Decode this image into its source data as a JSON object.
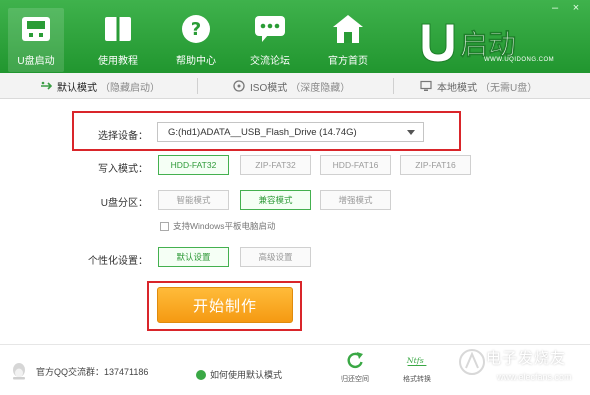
{
  "nav": {
    "items": [
      {
        "label": "U盘启动",
        "icon": "usb-drive-icon",
        "active": true
      },
      {
        "label": "使用教程",
        "icon": "book-icon",
        "active": false
      },
      {
        "label": "帮助中心",
        "icon": "question-icon",
        "active": false
      },
      {
        "label": "交流论坛",
        "icon": "chat-icon",
        "active": false
      },
      {
        "label": "官方首页",
        "icon": "home-icon",
        "active": false
      }
    ]
  },
  "brand": {
    "logo_text": "U启动",
    "logo_sub": "WWW.UQIDONG.COM"
  },
  "tabs": [
    {
      "label": "默认模式",
      "note": "（隐藏启动）",
      "icon": "usb-plug-icon",
      "active": true
    },
    {
      "label": "ISO模式",
      "note": "（深度隐藏）",
      "icon": "disc-icon",
      "active": false
    },
    {
      "label": "本地模式",
      "note": "（无需U盘）",
      "icon": "monitor-icon",
      "active": false
    }
  ],
  "form": {
    "device_label": "选择设备：",
    "device_value": "G:(hd1)ADATA__USB_Flash_Drive (14.74G)",
    "write_label": "写入模式：",
    "write_modes": [
      "HDD-FAT32",
      "ZIP-FAT32",
      "HDD-FAT16",
      "ZIP-FAT16"
    ],
    "write_selected": 0,
    "partition_label": "U盘分区：",
    "partition_modes": [
      "智能模式",
      "兼容模式",
      "增强模式"
    ],
    "partition_selected": 1,
    "checkbox_label": "支持Windows平板电脑启动",
    "personalize_label": "个性化设置：",
    "personalize_options": [
      "默认设置",
      "高级设置"
    ],
    "personalize_selected": 0,
    "start_button": "开始制作"
  },
  "footer": {
    "qq_text": "官方QQ交流群：137471186",
    "help_link": "如何使用默认模式",
    "tools": [
      {
        "label": "归还空间",
        "icon": "restore-icon"
      },
      {
        "label": "格式转换",
        "icon": "ntfs-icon"
      }
    ]
  },
  "watermark": {
    "text": "电子发烧友",
    "url": "www.elecfans.com"
  },
  "colors": {
    "brand_green": "#21962f",
    "accent_orange": "#f59a12",
    "highlight_red": "#d9252a"
  }
}
